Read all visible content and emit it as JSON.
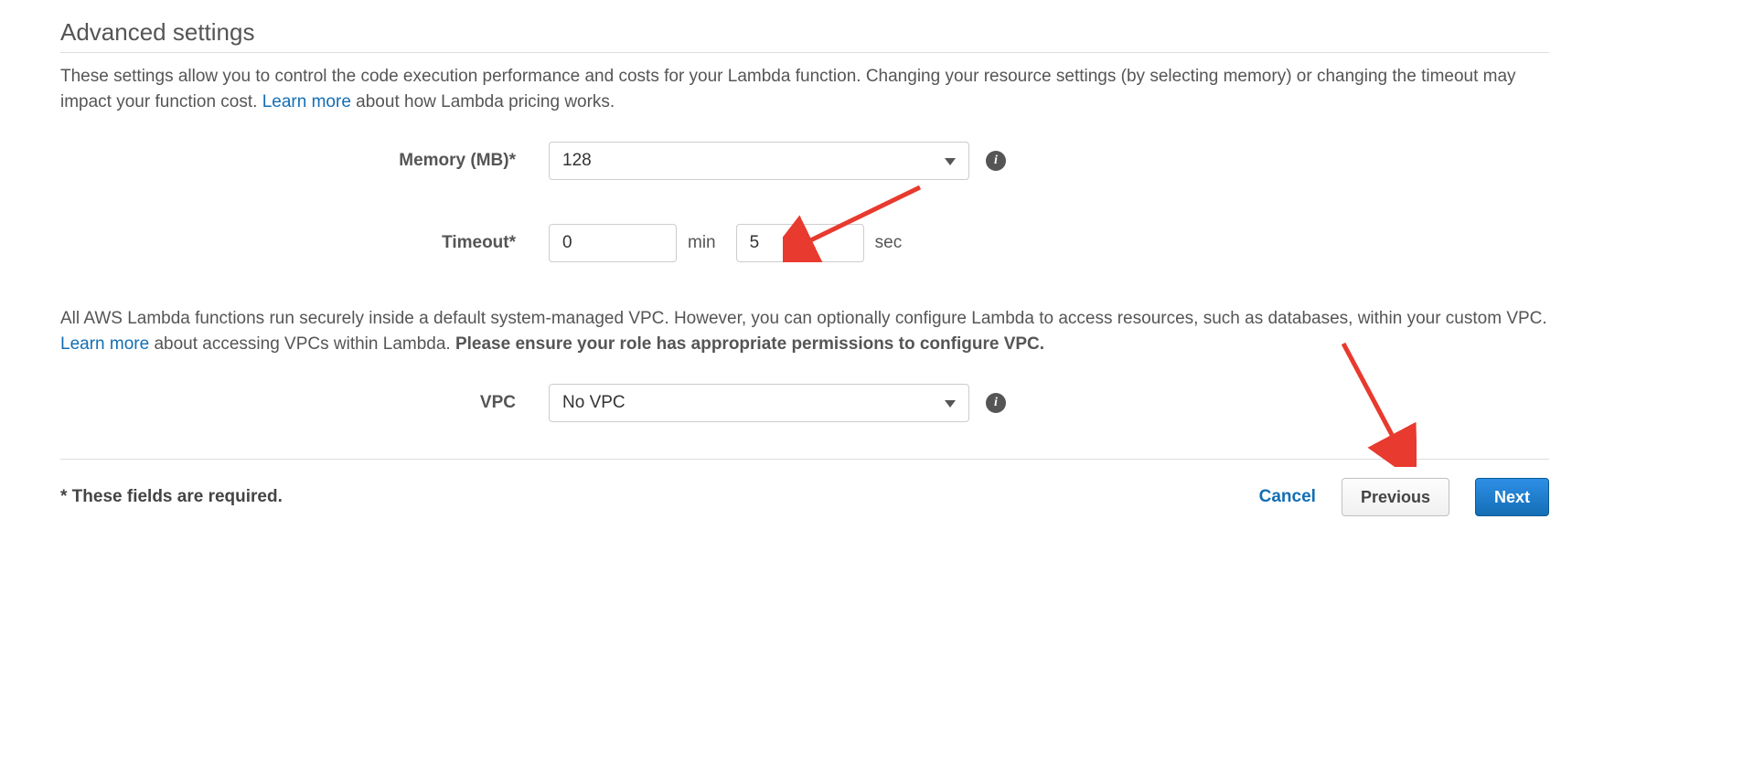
{
  "title": "Advanced settings",
  "intro": {
    "text_pre": "These settings allow you to control the code execution performance and costs for your Lambda function. Changing your resource settings (by selecting memory) or changing the timeout may impact your function cost. ",
    "learn_more": "Learn more",
    "text_post": " about how Lambda pricing works."
  },
  "memory": {
    "label": "Memory (MB)*",
    "value": "128"
  },
  "timeout": {
    "label": "Timeout*",
    "min": "0",
    "min_unit": "min",
    "sec": "5",
    "sec_unit": "sec"
  },
  "vpc_desc": {
    "text_pre": "All AWS Lambda functions run securely inside a default system-managed VPC. However, you can optionally configure Lambda to access resources, such as databases, within your custom VPC. ",
    "learn_more": "Learn more",
    "text_mid": " about accessing VPCs within Lambda. ",
    "bold": "Please ensure your role has appropriate permissions to configure VPC."
  },
  "vpc": {
    "label": "VPC",
    "value": "No VPC"
  },
  "footer": {
    "required_note": "* These fields are required.",
    "cancel": "Cancel",
    "previous": "Previous",
    "next": "Next"
  },
  "icons": {
    "info": "i"
  }
}
